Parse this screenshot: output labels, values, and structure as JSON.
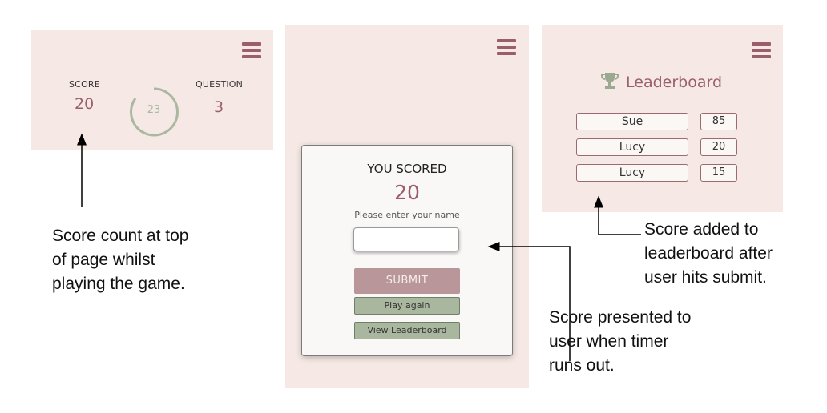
{
  "panel_game": {
    "score_label": "SCORE",
    "score_value": "20",
    "question_label": "QUESTION",
    "question_value": "3",
    "timer_value": "23"
  },
  "panel_modal": {
    "title": "YOU SCORED",
    "score": "20",
    "prompt": "Please enter your name",
    "input_value": "",
    "submit_label": "SUBMIT",
    "play_again_label": "Play again",
    "view_leaderboard_label": "View Leaderboard"
  },
  "panel_leaderboard": {
    "title": "Leaderboard",
    "entries": [
      {
        "name": "Sue",
        "score": "85"
      },
      {
        "name": "Lucy",
        "score": "20"
      },
      {
        "name": "Lucy",
        "score": "15"
      }
    ]
  },
  "captions": {
    "score_count": [
      "Score count at top",
      "of page whilst",
      "playing the game."
    ],
    "score_presented": [
      "Score presented to",
      "user when timer",
      "runs out."
    ],
    "score_added": [
      "Score added to",
      "leaderboard after",
      "user hits submit."
    ]
  },
  "colors": {
    "panel_bg": "#f6e9e5",
    "accent": "#9a5f6a",
    "green": "#aab79f",
    "trophy": "#9aa98f"
  },
  "icons": [
    "menu-icon",
    "trophy-icon"
  ]
}
